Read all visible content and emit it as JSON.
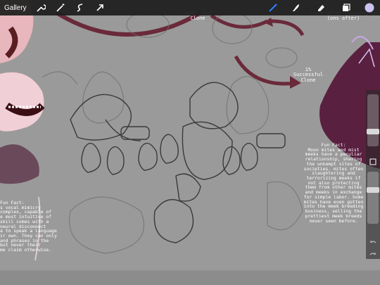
{
  "app": {
    "gallery_label": "Gallery"
  },
  "toolbar": {
    "left_tools": [
      "wrench-icon",
      "magic-wand-icon",
      "selection-icon",
      "transform-arrow-icon"
    ],
    "right_tools": [
      "brush-icon",
      "smudge-icon",
      "eraser-icon",
      "layers-icon",
      "color-swatch"
    ],
    "active_tool": "brush-icon",
    "accent_color": "#2f7cff",
    "current_color": "#c9c3ee"
  },
  "sidebar": {
    "brush_size_level": 0.62,
    "opacity_level": 0.48,
    "modify_button_icon": "square-icon",
    "undo_icon": "undo-icon",
    "redo_icon": "redo-icon"
  },
  "canvas_text": {
    "top_center_label": "Successful\nClone",
    "top_right_label": "other after recovery or\n(ons after)",
    "mid_right_label": "1%\nSuccessful\nClone",
    "fun_fact_right": "Fun Fact:\nMoon mites and mist\nmeeks have a peculiar\nrelationship, sharing\nthe unkempt sites of\nsocieties. mites often\nslaughtering and\nterrorizing meeks if\nnot also protecting\nthem from other mites\nand meeks in exchange\nfor simple labor. Some\nmites have even gotten\ninto the meek breeding\nbusiness, selling the\nprettiest meek breeds\nnever seen before.",
    "fun_fact_left": "Fun Fact:\ns vocal mimicry\ncomplex, capable of\ne most intuitive of\nskill comes with a\nneural disconnect\na to speak a language\nir own. They can only\nand phrases in the\nbut never their\nme claim otherwise."
  }
}
